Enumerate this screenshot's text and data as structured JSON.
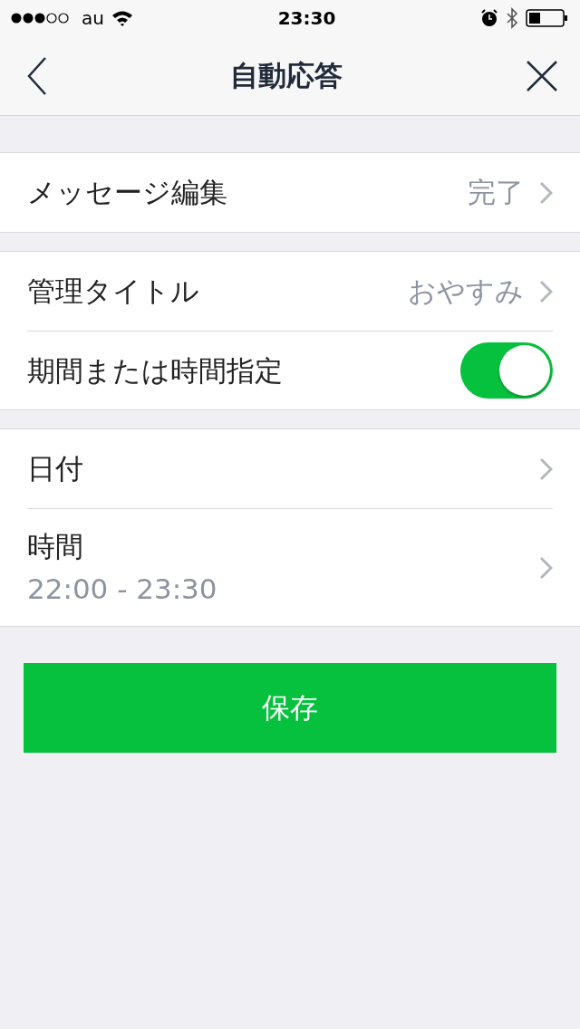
{
  "status_bar": {
    "carrier": "au",
    "time": "23:30"
  },
  "nav": {
    "title": "自動応答"
  },
  "sections": [
    {
      "rows": [
        {
          "kind": "link",
          "label": "メッセージ編集",
          "value": "完了"
        }
      ]
    },
    {
      "rows": [
        {
          "kind": "link",
          "label": "管理タイトル",
          "value": "おやすみ"
        },
        {
          "kind": "toggle",
          "label": "期間または時間指定",
          "on": true
        }
      ]
    },
    {
      "rows": [
        {
          "kind": "link",
          "label": "日付"
        },
        {
          "kind": "link",
          "label": "時間",
          "detail": "22:00 - 23:30"
        }
      ]
    }
  ],
  "save_button": "保存"
}
